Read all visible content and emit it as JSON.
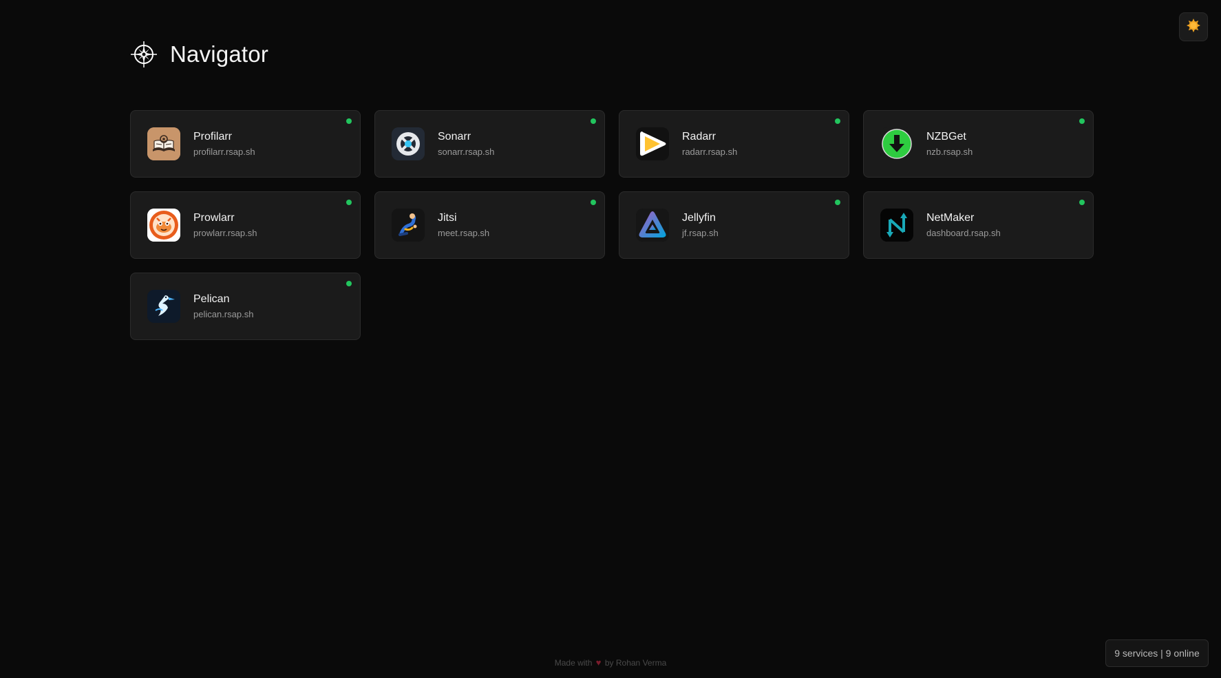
{
  "header": {
    "title": "Navigator",
    "logo_icon": "compass-icon"
  },
  "theme_toggle": {
    "icon": "sun-icon",
    "color": "#f5a623"
  },
  "status_color": "#22c55e",
  "services": [
    {
      "name": "Profilarr",
      "url": "profilarr.rsap.sh",
      "icon": "profilarr-icon"
    },
    {
      "name": "Sonarr",
      "url": "sonarr.rsap.sh",
      "icon": "sonarr-icon"
    },
    {
      "name": "Radarr",
      "url": "radarr.rsap.sh",
      "icon": "radarr-icon"
    },
    {
      "name": "NZBGet",
      "url": "nzb.rsap.sh",
      "icon": "nzbget-icon"
    },
    {
      "name": "Prowlarr",
      "url": "prowlarr.rsap.sh",
      "icon": "prowlarr-icon"
    },
    {
      "name": "Jitsi",
      "url": "meet.rsap.sh",
      "icon": "jitsi-icon"
    },
    {
      "name": "Jellyfin",
      "url": "jf.rsap.sh",
      "icon": "jellyfin-icon"
    },
    {
      "name": "NetMaker",
      "url": "dashboard.rsap.sh",
      "icon": "netmaker-icon"
    },
    {
      "name": "Pelican",
      "url": "pelican.rsap.sh",
      "icon": "pelican-icon"
    }
  ],
  "footer": {
    "made_with": "Made with",
    "heart": "♥",
    "by": "by Rohan Verma"
  },
  "status_summary": "9 services | 9 online"
}
